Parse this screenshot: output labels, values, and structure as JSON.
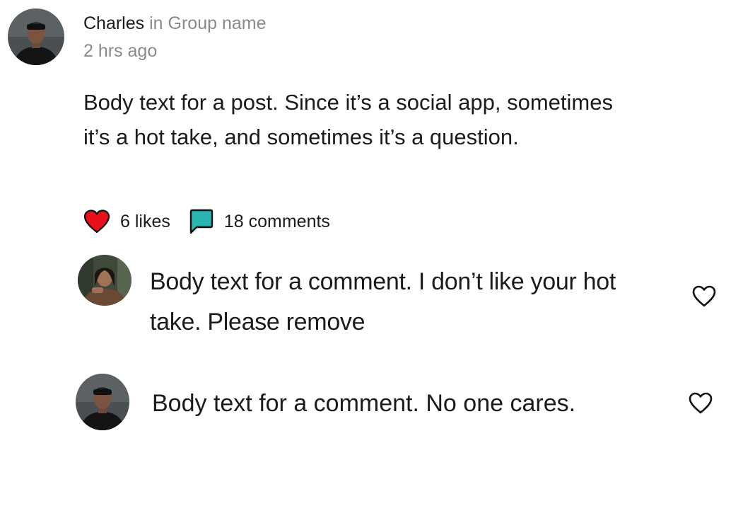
{
  "post": {
    "author": "Charles",
    "group_prefix": "in",
    "group_name": "Group name",
    "timestamp": "2 hrs ago",
    "avatar_icon": "avatar-photo",
    "body": "Body text for a post. Since it’s a social app, sometimes it’s a hot take, and sometimes it’s a question.",
    "likes_label": "6 likes",
    "comments_label": "18 comments",
    "likes_icon": "heart-filled-icon",
    "comments_icon": "comment-bubble-icon"
  },
  "comments": [
    {
      "text": "Body text for a comment. I don’t like your hot take. Please remove",
      "avatar_icon": "avatar-photo",
      "like_icon": "heart-outline-icon"
    },
    {
      "text": "Body text for a comment. No one cares.",
      "avatar_icon": "avatar-photo",
      "like_icon": "heart-outline-icon"
    }
  ],
  "colors": {
    "heart_red": "#e8101b",
    "comment_teal": "#2bb5b0",
    "text_primary": "#1b1b1b",
    "text_secondary": "#8a8a8a"
  }
}
